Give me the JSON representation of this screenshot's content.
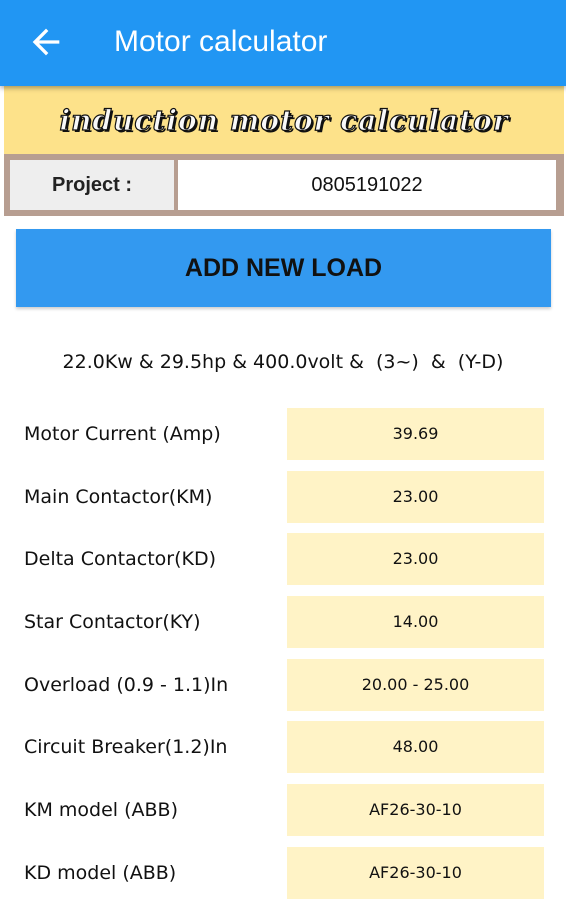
{
  "appbar": {
    "title": "Motor calculator",
    "back_icon": "arrow-left-icon",
    "color": "#2196f3"
  },
  "banner": {
    "text": "induction motor calculator"
  },
  "project": {
    "label": "Project :",
    "value": "0805191022"
  },
  "add_button": {
    "label": "ADD NEW LOAD"
  },
  "summary": {
    "text": "22.0Kw & 29.5hp & 400.0volt &  (3~)  &  (Y-D)"
  },
  "results": [
    {
      "label": "Motor Current (Amp)",
      "value": "39.69"
    },
    {
      "label": "Main Contactor(KM)",
      "value": "23.00"
    },
    {
      "label": "Delta Contactor(KD)",
      "value": "23.00"
    },
    {
      "label": "Star Contactor(KY)",
      "value": "14.00"
    },
    {
      "label": "Overload (0.9 - 1.1)In",
      "value": "20.00 - 25.00"
    },
    {
      "label": "Circuit Breaker(1.2)In",
      "value": "48.00"
    },
    {
      "label": "KM model (ABB)",
      "value": "AF26-30-10"
    },
    {
      "label": "KD model (ABB)",
      "value": "AF26-30-10"
    }
  ]
}
